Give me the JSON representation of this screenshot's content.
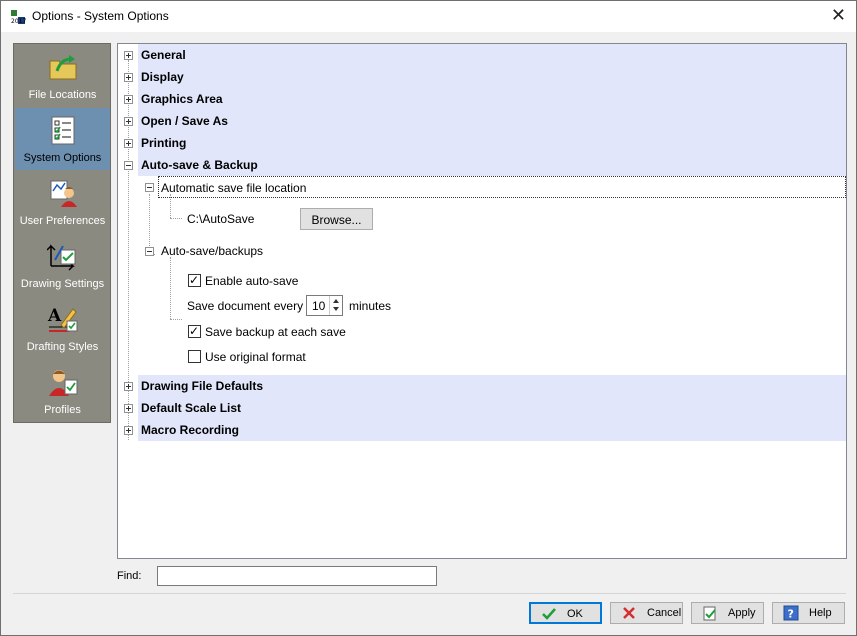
{
  "window": {
    "title": "Options - System Options",
    "close_glyph": "✕"
  },
  "categories": [
    {
      "label": "File Locations",
      "icon": "folder-arrow-icon"
    },
    {
      "label": "System Options",
      "icon": "checklist-icon",
      "selected": true
    },
    {
      "label": "User Preferences",
      "icon": "user-preferences-icon"
    },
    {
      "label": "Drawing Settings",
      "icon": "drawing-settings-icon"
    },
    {
      "label": "Drafting Styles",
      "icon": "drafting-styles-icon"
    },
    {
      "label": "Profiles",
      "icon": "profiles-icon"
    }
  ],
  "tree": {
    "sections_top": [
      {
        "label": "General"
      },
      {
        "label": "Display"
      },
      {
        "label": "Graphics Area"
      },
      {
        "label": "Open / Save As"
      },
      {
        "label": "Printing"
      }
    ],
    "expanded_section": {
      "label": "Auto-save & Backup",
      "autosave_location": {
        "label": "Automatic save file location",
        "path": "C:\\AutoSave",
        "browse_label": "Browse..."
      },
      "autosave_backups": {
        "label": "Auto-save/backups",
        "enable_autosave": {
          "label": "Enable auto-save",
          "checked": true
        },
        "save_every": {
          "label": "Save document every",
          "value": "10",
          "unit": "minutes"
        },
        "save_backup": {
          "label": "Save backup at each save",
          "checked": true
        },
        "original_format": {
          "label": "Use original format",
          "checked": false
        }
      }
    },
    "sections_bottom": [
      {
        "label": "Drawing File Defaults"
      },
      {
        "label": "Default Scale List"
      },
      {
        "label": "Macro Recording"
      }
    ]
  },
  "find": {
    "label": "Find:",
    "value": ""
  },
  "buttons": {
    "ok": "OK",
    "cancel": "Cancel",
    "apply": "Apply",
    "help": "Help"
  },
  "colors": {
    "section_header_bg": "#e1e6fa",
    "category_panel_bg": "#8a8a80",
    "category_selected_bg": "#6d8fb0",
    "default_button_border": "#0078d7"
  }
}
